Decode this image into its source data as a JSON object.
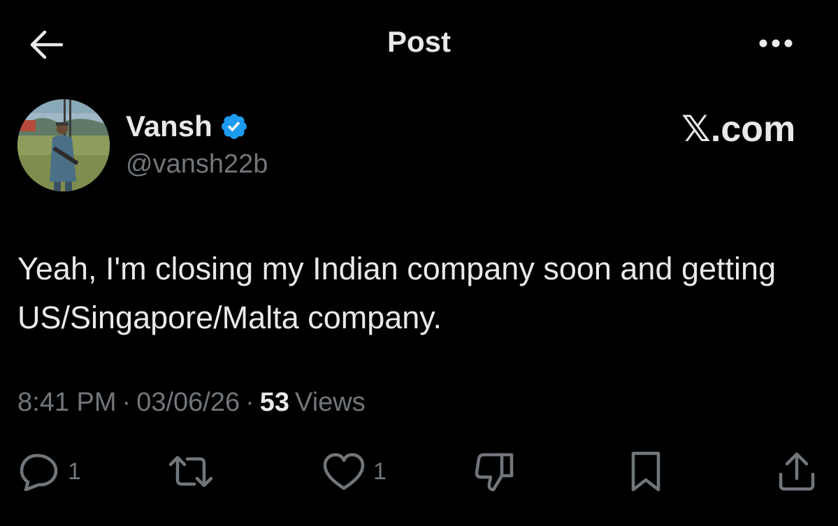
{
  "header": {
    "title": "Post",
    "back_icon": "arrow-left-icon",
    "more_icon": "more-horizontal-icon"
  },
  "author": {
    "name": "Vansh",
    "handle": "@vansh22b",
    "verified": true,
    "verified_color": "#1d9bf0"
  },
  "watermark": "𝕏.com",
  "post": {
    "text": "Yeah, I'm closing my Indian company soon and getting US/Singapore/Malta company."
  },
  "meta": {
    "time": "8:41 PM",
    "date": "03/06/26",
    "views_count": "53",
    "views_label": "Views"
  },
  "actions": {
    "reply": {
      "icon": "reply-icon",
      "count": "1"
    },
    "repost": {
      "icon": "repost-icon",
      "count": ""
    },
    "like": {
      "icon": "heart-icon",
      "count": "1"
    },
    "dislike": {
      "icon": "thumbs-down-icon",
      "count": ""
    },
    "bookmark": {
      "icon": "bookmark-icon",
      "count": ""
    },
    "share": {
      "icon": "share-icon",
      "count": ""
    }
  },
  "colors": {
    "background": "#000000",
    "primary_text": "#e7e9ea",
    "secondary_text": "#71767b",
    "accent": "#1d9bf0"
  }
}
